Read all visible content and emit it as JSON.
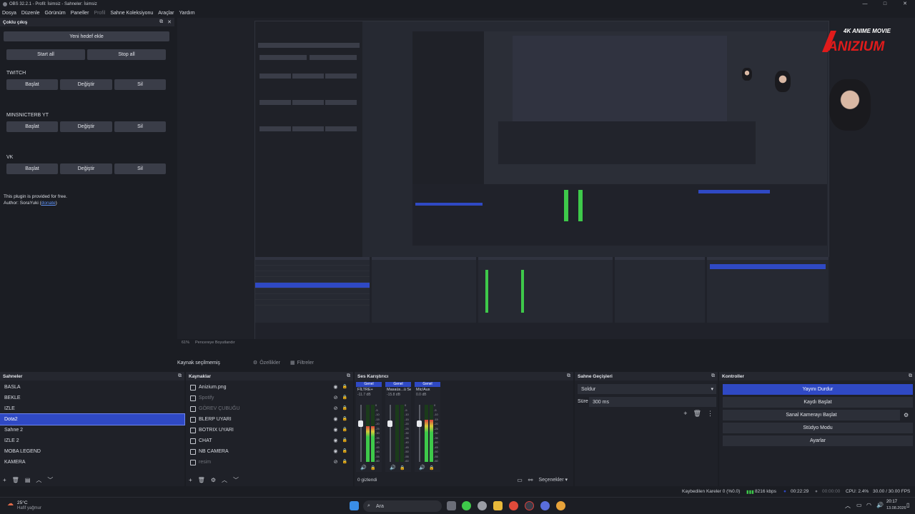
{
  "window": {
    "title": "OBS 32.2.1 - Profil: İsimsiz - Sahneler: İsimsiz",
    "controls": [
      "—",
      "□",
      "✕"
    ]
  },
  "menu": [
    "Dosya",
    "Düzenle",
    "Görünüm",
    "Paneller",
    "Profil",
    "Sahne Koleksiyonu",
    "Araçlar",
    "Yardım"
  ],
  "multi_output": {
    "title": "Çoklu çıkış",
    "new_target": "Yeni hedef ekle",
    "start_all": "Start all",
    "stop_all": "Stop all",
    "targets": [
      {
        "name": "TWITCH",
        "start": "Başlat",
        "edit": "Değiştir",
        "delete": "Sil"
      },
      {
        "name": "MINSNICTERB YT",
        "start": "Başlat",
        "edit": "Değiştir",
        "delete": "Sil"
      },
      {
        "name": "VK",
        "start": "Başlat",
        "edit": "Değiştir",
        "delete": "Sil"
      }
    ],
    "free_note": "This plugin is provided for free.",
    "author_prefix": "Author: SoraYuki (",
    "author_link": "donate",
    "author_suffix": ")"
  },
  "preview": {
    "logo_top": "4K ANIME MOVIE",
    "logo_main": "ANIZIUM",
    "zoom": "61%",
    "fit_label": "Pencereye Boyutlandır"
  },
  "source_bar": {
    "no_source": "Kaynak seçilmemiş",
    "properties": "Özellikler",
    "filters": "Filtreler"
  },
  "scenes": {
    "title": "Sahneler",
    "items": [
      "BASLA",
      "BEKLE",
      "IZLE",
      "Dota2",
      "Sahne 2",
      "IZLE 2",
      "MOBA LEGEND",
      "KAMERA"
    ],
    "selected_index": 3
  },
  "sources": {
    "title": "Kaynaklar",
    "items": [
      {
        "name": "Anizium.png",
        "visible": true
      },
      {
        "name": "Spotify",
        "visible": false
      },
      {
        "name": "GÖREV ÇUBUĞU",
        "visible": false
      },
      {
        "name": "BLERP UYARI",
        "visible": true
      },
      {
        "name": "BOTRIX UYARI",
        "visible": true
      },
      {
        "name": "CHAT",
        "visible": true
      },
      {
        "name": "NB CAMERA",
        "visible": true
      },
      {
        "name": "resim",
        "visible": false
      }
    ],
    "hidden_count": "0 gizlendi"
  },
  "mixer": {
    "title": "Ses Karıştırıcı",
    "channels": [
      {
        "head": "Genel",
        "name": "FİLTRE+",
        "db": "-11.7 dB",
        "level": 0.62
      },
      {
        "head": "Genel",
        "name": "Masaüs...ü Ses",
        "db": "-15.8 dB",
        "level": 0.0
      },
      {
        "head": "Genel",
        "name": "Mic/Aux",
        "db": "0.0 dB",
        "level": 0.74
      }
    ],
    "scale": [
      "0",
      "-5",
      "-10",
      "-15",
      "-20",
      "-25",
      "-30",
      "-35",
      "-40",
      "-45",
      "-50",
      "-55",
      "-60"
    ],
    "options": "Seçenekler"
  },
  "transitions": {
    "title": "Sahne Geçişleri",
    "type": "Soldur",
    "duration_label": "Süre",
    "duration": "300 ms"
  },
  "controls": {
    "title": "Kontroller",
    "stop_stream": "Yayını Durdur",
    "start_recording": "Kaydı Başlat",
    "virtual_cam": "Sanal Kamerayı Başlat",
    "studio_mode": "Stüdyo Modu",
    "settings": "Ayarlar"
  },
  "status": {
    "dropped_frames": "Kaybedilen Kareler 0 (%0.0)",
    "bitrate": "8216 kbps",
    "stream_time": "00:22:29",
    "rec_time": "00:00:00",
    "cpu": "CPU: 2.4%",
    "fps": "30.00 / 30.00 FPS"
  },
  "taskbar": {
    "weather_temp": "25°C",
    "weather_desc": "Hafif yağmur",
    "search": "Ara",
    "time": "20:17",
    "date": "13.08.2026"
  },
  "colors": {
    "accent": "#2f49c4",
    "background": "#1b1d23",
    "panel": "#1f2128",
    "meter_green": "#3ec94a",
    "meter_yellow": "#d6c93a",
    "meter_red": "#d9413d"
  }
}
